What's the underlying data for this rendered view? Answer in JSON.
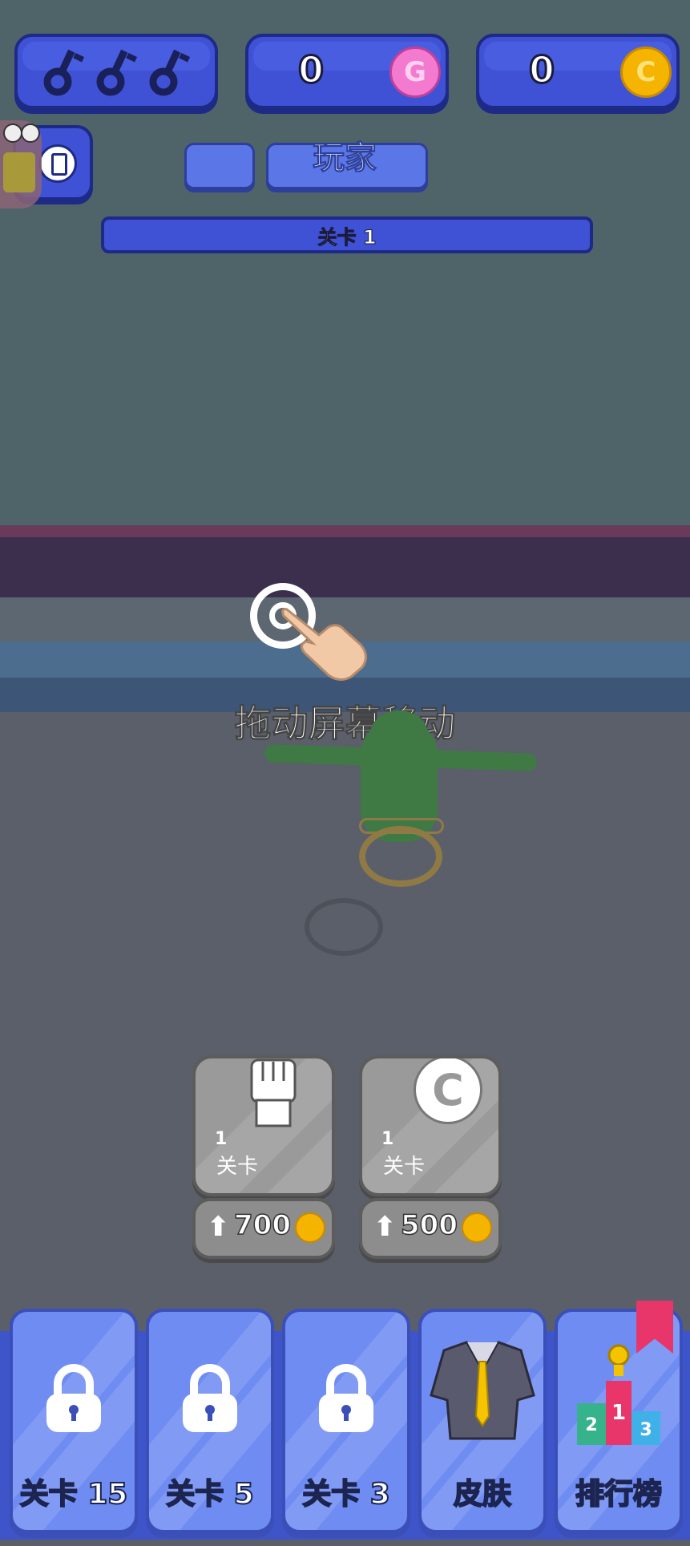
{
  "top_bar": {
    "keys_count": 3,
    "gems": "0",
    "coins": "0",
    "gem_symbol": "G",
    "coin_symbol": "C"
  },
  "player": {
    "name": "玩家",
    "level_label": "关卡 1"
  },
  "hint": "拖动屏幕移动",
  "upgrades": [
    {
      "icon": "fist-icon",
      "level": "1",
      "label": "关卡",
      "price": "700"
    },
    {
      "icon": "coin-icon",
      "level": "1",
      "label": "关卡",
      "price": "500"
    }
  ],
  "bottom_nav": [
    {
      "label": "关卡  15",
      "icon": "lock-icon",
      "locked": true
    },
    {
      "label": "关卡  5",
      "icon": "lock-icon",
      "locked": true
    },
    {
      "label": "关卡  3",
      "icon": "lock-icon",
      "locked": true
    },
    {
      "label": "皮肤",
      "icon": "shirt-icon",
      "locked": false
    },
    {
      "label": "排行榜",
      "icon": "podium-icon",
      "locked": false
    }
  ],
  "colors": {
    "background": "#4d5f64",
    "blue_button": "#3f52d6",
    "nav_tile": "#6f8cf2",
    "gem": "#f47ad0",
    "coin": "#f5b400"
  }
}
